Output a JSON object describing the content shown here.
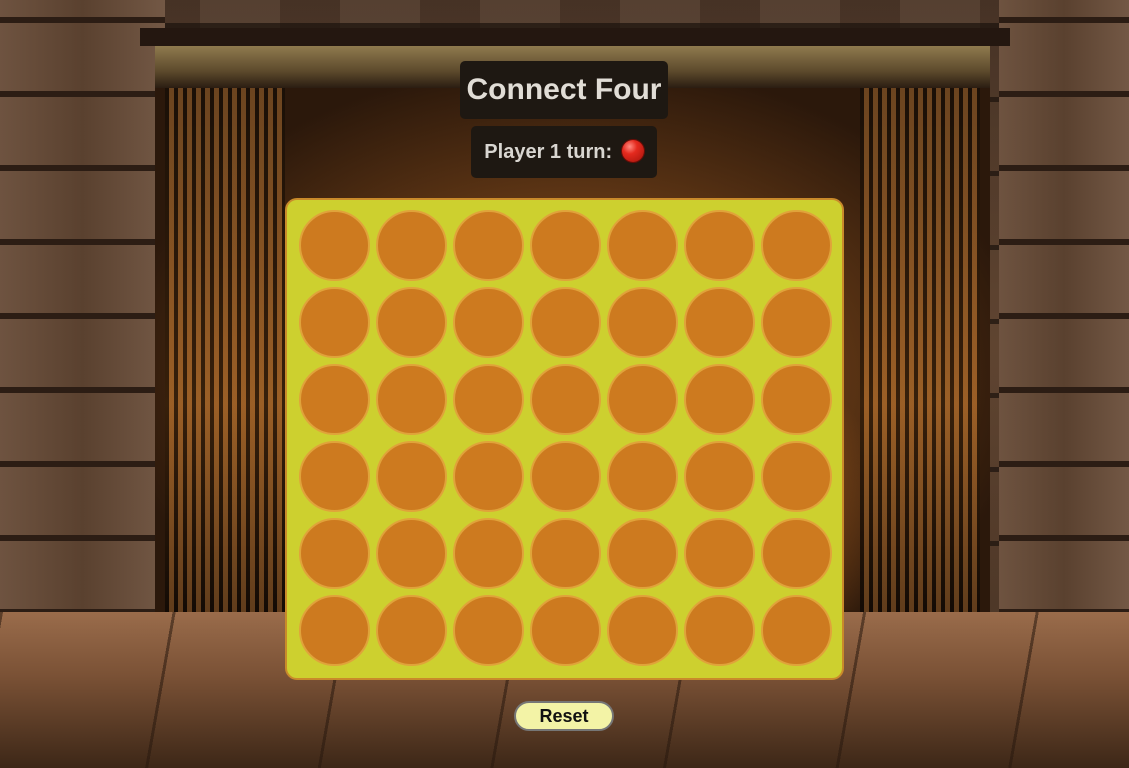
{
  "game": {
    "title": "Connect Four",
    "status_prefix": "Player 1 turn:",
    "current_player": 1,
    "current_token_color": "#e42a1e",
    "rows": 6,
    "columns": 7,
    "board": [
      [
        "",
        "",
        "",
        "",
        "",
        "",
        ""
      ],
      [
        "",
        "",
        "",
        "",
        "",
        "",
        ""
      ],
      [
        "",
        "",
        "",
        "",
        "",
        "",
        ""
      ],
      [
        "",
        "",
        "",
        "",
        "",
        "",
        ""
      ],
      [
        "",
        "",
        "",
        "",
        "",
        "",
        ""
      ],
      [
        "",
        "",
        "",
        "",
        "",
        "",
        ""
      ]
    ],
    "reset_label": "Reset"
  },
  "colors": {
    "board": "#cdd02f",
    "empty_slot": "#cd7a1f",
    "reset_button": "#f3f3a6",
    "panel": "#1e1812"
  }
}
